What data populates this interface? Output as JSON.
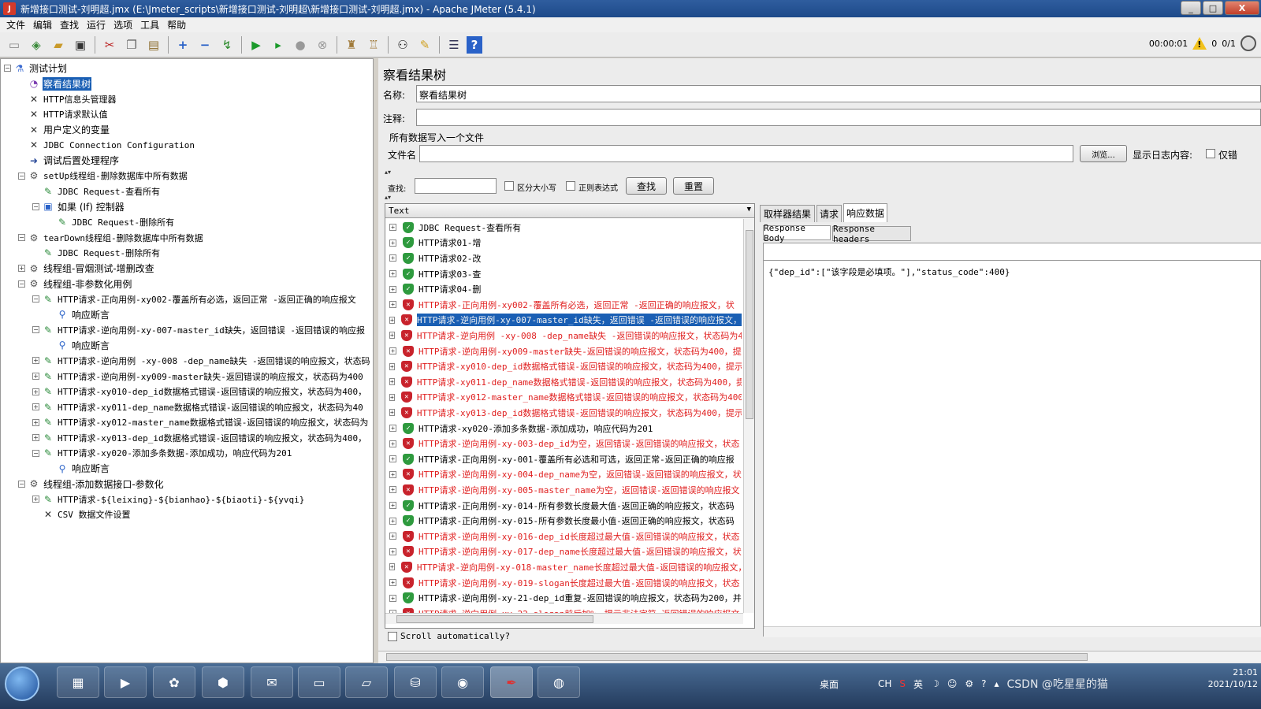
{
  "window": {
    "title": "新增接口测试-刘明超.jmx (E:\\Jmeter_scripts\\新增接口测试-刘明超\\新增接口测试-刘明超.jmx) - Apache JMeter (5.4.1)",
    "buttons": [
      "_",
      "□",
      "X"
    ]
  },
  "menu": [
    "文件",
    "编辑",
    "查找",
    "运行",
    "选项",
    "工具",
    "帮助"
  ],
  "toolbar": {
    "timer": "00:00:01",
    "warnings": "0",
    "threads": "0/1"
  },
  "tree": [
    {
      "label": "测试计划",
      "icon": "test-plan-icon",
      "level": 0,
      "toggle": "-"
    },
    {
      "label": "察看结果树",
      "icon": "chart-icon",
      "level": 1,
      "selected": true
    },
    {
      "label": "HTTP信息头管理器",
      "icon": "tool-icon",
      "level": 1,
      "code": true
    },
    {
      "label": "HTTP请求默认值",
      "icon": "tool-icon",
      "level": 1,
      "code": true
    },
    {
      "label": "用户定义的变量",
      "icon": "tool-icon",
      "level": 1
    },
    {
      "label": "JDBC Connection Configuration",
      "icon": "tool-icon",
      "level": 1,
      "code": true
    },
    {
      "label": "调试后置处理程序",
      "icon": "arrow-icon",
      "level": 1
    },
    {
      "label": "setUp线程组-删除数据库中所有数据",
      "icon": "gear-icon",
      "level": 1,
      "toggle": "-",
      "code": true
    },
    {
      "label": "JDBC Request-查看所有",
      "icon": "pencil-icon",
      "level": 2,
      "code": true
    },
    {
      "label": "如果 (If) 控制器",
      "icon": "controller-icon",
      "level": 2,
      "toggle": "-"
    },
    {
      "label": "JDBC Request-删除所有",
      "icon": "pencil-icon",
      "level": 3,
      "code": true
    },
    {
      "label": "tearDown线程组-删除数据库中所有数据",
      "icon": "gear-icon",
      "level": 1,
      "toggle": "-",
      "code": true
    },
    {
      "label": "JDBC Request-删除所有",
      "icon": "pencil-icon",
      "level": 2,
      "code": true
    },
    {
      "label": "线程组-冒烟测试-增删改查",
      "icon": "gear-icon",
      "level": 1,
      "toggle": "+"
    },
    {
      "label": "线程组-非参数化用例",
      "icon": "gear-icon",
      "level": 1,
      "toggle": "-"
    },
    {
      "label": "HTTP请求-正向用例-xy002-覆盖所有必选，返回正常 -返回正确的响应报文",
      "icon": "pencil-icon",
      "level": 2,
      "toggle": "-",
      "code": true
    },
    {
      "label": "响应断言",
      "icon": "magnifier-icon",
      "level": 3
    },
    {
      "label": "HTTP请求-逆向用例-xy-007-master_id缺失，返回错误 -返回错误的响应报",
      "icon": "pencil-icon",
      "level": 2,
      "toggle": "-",
      "code": true
    },
    {
      "label": "响应断言",
      "icon": "magnifier-icon",
      "level": 3
    },
    {
      "label": "HTTP请求-逆向用例 -xy-008 -dep_name缺失 -返回错误的响应报文，状态码",
      "icon": "pencil-icon",
      "level": 2,
      "toggle": "+",
      "code": true
    },
    {
      "label": "HTTP请求-逆向用例-xy009-master缺失-返回错误的响应报文，状态码为400",
      "icon": "pencil-icon",
      "level": 2,
      "toggle": "+",
      "code": true
    },
    {
      "label": "HTTP请求-xy010-dep_id数据格式错误-返回错误的响应报文，状态码为400，",
      "icon": "pencil-icon",
      "level": 2,
      "toggle": "+",
      "code": true
    },
    {
      "label": "HTTP请求-xy011-dep_name数据格式错误-返回错误的响应报文，状态码为40",
      "icon": "pencil-icon",
      "level": 2,
      "toggle": "+",
      "code": true
    },
    {
      "label": "HTTP请求-xy012-master_name数据格式错误-返回错误的响应报文，状态码为",
      "icon": "pencil-icon",
      "level": 2,
      "toggle": "+",
      "code": true
    },
    {
      "label": "HTTP请求-xy013-dep_id数据格式错误-返回错误的响应报文，状态码为400，",
      "icon": "pencil-icon",
      "level": 2,
      "toggle": "+",
      "code": true
    },
    {
      "label": "HTTP请求-xy020-添加多条数据-添加成功，响应代码为201",
      "icon": "pencil-icon",
      "level": 2,
      "toggle": "-",
      "code": true
    },
    {
      "label": "响应断言",
      "icon": "magnifier-icon",
      "level": 3
    },
    {
      "label": "线程组-添加数据接口-参数化",
      "icon": "gear-icon",
      "level": 1,
      "toggle": "-"
    },
    {
      "label": "HTTP请求-${leixing}-${bianhao}-${biaoti}-${yvqi}",
      "icon": "pencil-icon",
      "level": 2,
      "toggle": "+",
      "code": true
    },
    {
      "label": "CSV 数据文件设置",
      "icon": "tool-icon",
      "level": 2,
      "code": true
    }
  ],
  "panel": {
    "title": "察看结果树",
    "name_label": "名称:",
    "name_value": "察看结果树",
    "comment_label": "注释:",
    "comment_value": "",
    "file_section": "所有数据写入一个文件",
    "file_label": "文件名",
    "file_value": "",
    "browse_label": "浏览...",
    "log_label": "显示日志内容:",
    "errors_label": "仅错",
    "search_label": "查找:",
    "case_label": "区分大小写",
    "regex_label": "正则表达式",
    "find_button": "查找",
    "reset_button": "重置",
    "list_header": "Text",
    "scroll_label": "Scroll automatically?"
  },
  "results": [
    {
      "text": "JDBC Request-查看所有",
      "status": "ok"
    },
    {
      "text": "HTTP请求01-增",
      "status": "ok"
    },
    {
      "text": "HTTP请求02-改",
      "status": "ok"
    },
    {
      "text": "HTTP请求03-查",
      "status": "ok"
    },
    {
      "text": "HTTP请求04-删",
      "status": "ok"
    },
    {
      "text": "HTTP请求-正向用例-xy002-覆盖所有必选，返回正常 -返回正确的响应报文，状",
      "status": "fail"
    },
    {
      "text": "HTTP请求-逆向用例-xy-007-master_id缺失，返回错误 -返回错误的响应报文，",
      "status": "fail",
      "selected": true
    },
    {
      "text": "HTTP请求-逆向用例 -xy-008 -dep_name缺失 -返回错误的响应报文，状态码为4",
      "status": "fail"
    },
    {
      "text": "HTTP请求-逆向用例-xy009-master缺失-返回错误的响应报文，状态码为400，提",
      "status": "fail"
    },
    {
      "text": "HTTP请求-xy010-dep_id数据格式错误-返回错误的响应报文，状态码为400，提示",
      "status": "fail"
    },
    {
      "text": "HTTP请求-xy011-dep_name数据格式错误-返回错误的响应报文，状态码为400，提",
      "status": "fail"
    },
    {
      "text": "HTTP请求-xy012-master_name数据格式错误-返回错误的响应报文，状态码为400",
      "status": "fail"
    },
    {
      "text": "HTTP请求-xy013-dep_id数据格式错误-返回错误的响应报文，状态码为400，提示",
      "status": "fail"
    },
    {
      "text": "HTTP请求-xy020-添加多条数据-添加成功，响应代码为201",
      "status": "ok"
    },
    {
      "text": "HTTP请求-逆向用例-xy-003-dep_id为空，返回错误-返回错误的响应报文，状态",
      "status": "fail"
    },
    {
      "text": "HTTP请求-正向用例-xy-001-覆盖所有必选和可选，返回正常-返回正确的响应报",
      "status": "ok"
    },
    {
      "text": "HTTP请求-逆向用例-xy-004-dep_name为空，返回错误-返回错误的响应报文，状",
      "status": "fail"
    },
    {
      "text": "HTTP请求-逆向用例-xy-005-master_name为空，返回错误-返回错误的响应报文",
      "status": "fail"
    },
    {
      "text": "HTTP请求-正向用例-xy-014-所有参数长度最大值-返回正确的响应报文，状态码",
      "status": "ok"
    },
    {
      "text": "HTTP请求-正向用例-xy-015-所有参数长度最小值-返回正确的响应报文，状态码",
      "status": "ok"
    },
    {
      "text": "HTTP请求-逆向用例-xy-016-dep_id长度超过最大值-返回错误的响应报文，状态",
      "status": "fail"
    },
    {
      "text": "HTTP请求-逆向用例-xy-017-dep_name长度超过最大值-返回错误的响应报文，状",
      "status": "fail"
    },
    {
      "text": "HTTP请求-逆向用例-xy-018-master_name长度超过最大值-返回错误的响应报文，",
      "status": "fail"
    },
    {
      "text": "HTTP请求-逆向用例-xy-019-slogan长度超过最大值-返回错误的响应报文，状态",
      "status": "fail"
    },
    {
      "text": "HTTP请求-逆向用例-xy-21-dep_id重复-返回错误的响应报文，状态码为200，并",
      "status": "ok"
    },
    {
      "text": "HTTP请求-逆向用例-xy-22-slogan前后加%，提示非法字符-返回错误的响应报文",
      "status": "fail"
    }
  ],
  "detail": {
    "tabs": [
      "取样器结果",
      "请求",
      "响应数据"
    ],
    "subtabs": [
      "Response Body",
      "Response headers"
    ],
    "body": "{\"dep_id\":[\"该字段是必填项。\"],\"status_code\":400}"
  },
  "taskbar": {
    "apps": [
      "folder-app",
      "media-app",
      "photo-app",
      "nox-app",
      "wechat-app",
      "cmd-app",
      "notepad-app",
      "db-app",
      "cts-app",
      "jmeter-app",
      "chrome-app"
    ],
    "tray_desktop": "桌面",
    "tray_lang": "CH",
    "tray_ime": "英",
    "watermark": "CSDN @吃星星的猫",
    "time": "21:01",
    "date": "2021/10/12"
  },
  "colors": {
    "selected_bg": "#1a5fb4",
    "fail_text": "#e01f1f",
    "ok_shield": "#2e9a3e",
    "fail_shield": "#c8232c"
  }
}
